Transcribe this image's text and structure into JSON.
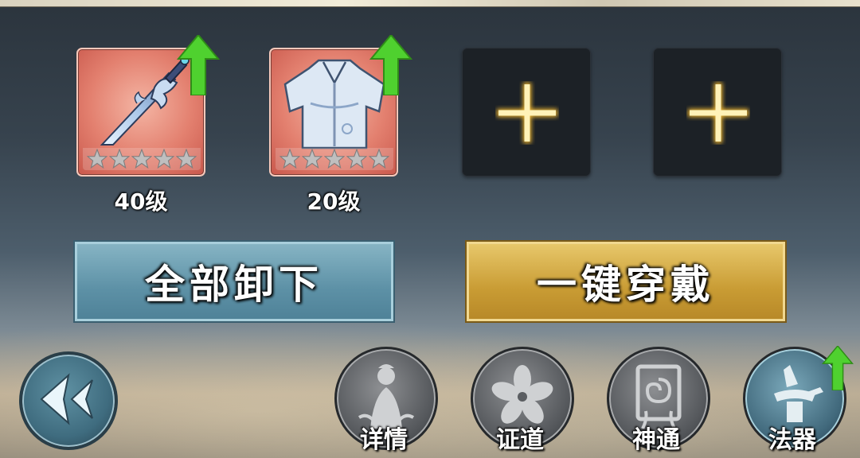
{
  "colors": {
    "accent_blue": "#5d91a6",
    "accent_gold": "#c99c34",
    "upgrade_green": "#4fd12f",
    "plus_glow": "#f4d97a"
  },
  "equipment_slots": [
    {
      "type": "sword",
      "state": "filled",
      "level": "40级",
      "stars": 5,
      "stars_lit": 0,
      "upgradable": true,
      "icon": "sword-icon"
    },
    {
      "type": "robe",
      "state": "filled",
      "level": "20级",
      "stars": 5,
      "stars_lit": 0,
      "upgradable": true,
      "icon": "robe-icon"
    },
    {
      "type": "empty",
      "state": "empty",
      "icon": "plus-icon"
    },
    {
      "type": "empty",
      "state": "empty",
      "icon": "plus-icon"
    }
  ],
  "actions": {
    "unequip_all": "全部卸下",
    "equip_all": "一键穿戴"
  },
  "nav": {
    "back_icon": "back-arrow-icon",
    "buttons": [
      {
        "label": "详情",
        "icon": "character-icon",
        "active": false
      },
      {
        "label": "证道",
        "icon": "flower-icon",
        "active": false
      },
      {
        "label": "神通",
        "icon": "talisman-icon",
        "active": false
      },
      {
        "label": "法器",
        "icon": "artifact-icon",
        "active": true,
        "upgradable": true
      }
    ]
  }
}
